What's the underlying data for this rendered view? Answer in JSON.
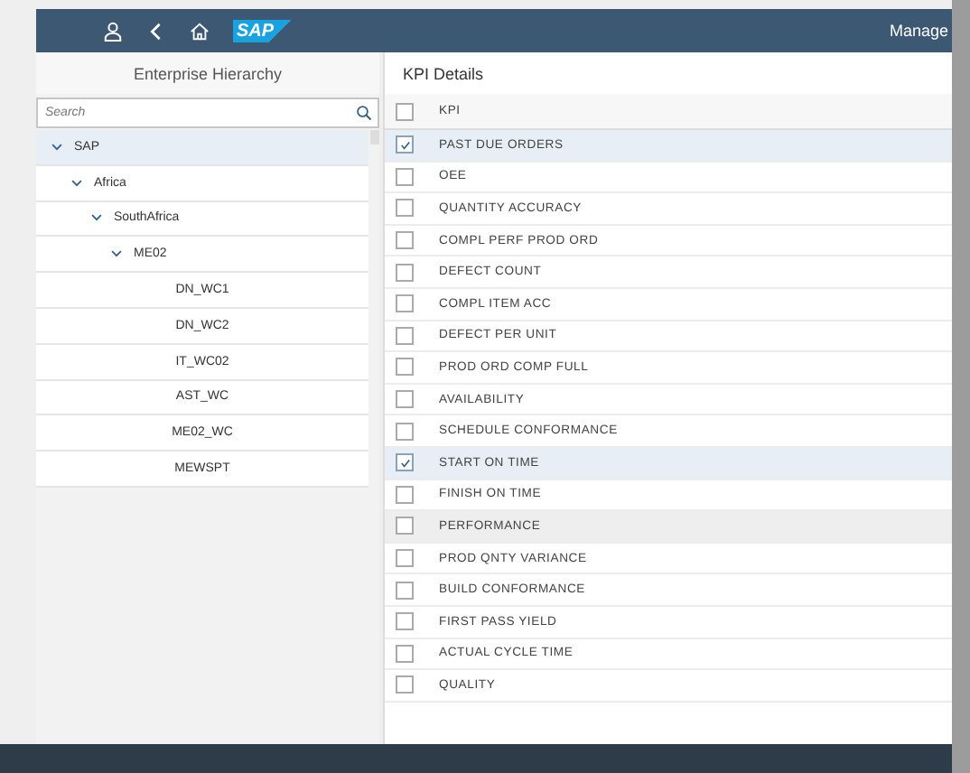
{
  "shell": {
    "title": "Manage",
    "logo": "SAP"
  },
  "hierarchy": {
    "title": "Enterprise Hierarchy",
    "search": {
      "placeholder": "Search"
    },
    "tree": [
      {
        "label": "SAP",
        "expanded": true,
        "selected": true,
        "children": [
          {
            "label": "Africa",
            "expanded": true,
            "selected": false,
            "children": [
              {
                "label": "SouthAfrica",
                "expanded": true,
                "selected": false,
                "children": [
                  {
                    "label": "ME02",
                    "expanded": true,
                    "selected": false,
                    "children": [
                      {
                        "label": "DN_WC1",
                        "selected": false
                      },
                      {
                        "label": "DN_WC2",
                        "selected": false
                      },
                      {
                        "label": "IT_WC02",
                        "selected": false
                      },
                      {
                        "label": "AST_WC",
                        "selected": false
                      },
                      {
                        "label": "ME02_WC",
                        "selected": false
                      },
                      {
                        "label": "MEWSPT",
                        "selected": false
                      }
                    ]
                  }
                ]
              }
            ]
          }
        ]
      }
    ]
  },
  "kpi": {
    "title": "KPI Details",
    "header": {
      "label": "KPI",
      "checked": false
    },
    "rows": [
      {
        "label": "PAST DUE ORDERS",
        "checked": true,
        "hovered": false
      },
      {
        "label": "OEE",
        "checked": false,
        "hovered": false
      },
      {
        "label": "QUANTITY ACCURACY",
        "checked": false,
        "hovered": false
      },
      {
        "label": "COMPL PERF PROD ORD",
        "checked": false,
        "hovered": false
      },
      {
        "label": "DEFECT COUNT",
        "checked": false,
        "hovered": false
      },
      {
        "label": "COMPL ITEM ACC",
        "checked": false,
        "hovered": false
      },
      {
        "label": "DEFECT PER UNIT",
        "checked": false,
        "hovered": false
      },
      {
        "label": "PROD ORD COMP FULL",
        "checked": false,
        "hovered": false
      },
      {
        "label": "AVAILABILITY",
        "checked": false,
        "hovered": false
      },
      {
        "label": "SCHEDULE CONFORMANCE",
        "checked": false,
        "hovered": false
      },
      {
        "label": "START ON TIME",
        "checked": true,
        "hovered": false
      },
      {
        "label": "FINISH ON TIME",
        "checked": false,
        "hovered": false
      },
      {
        "label": "PERFORMANCE",
        "checked": false,
        "hovered": true
      },
      {
        "label": "PROD QNTY VARIANCE",
        "checked": false,
        "hovered": false
      },
      {
        "label": "BUILD CONFORMANCE",
        "checked": false,
        "hovered": false
      },
      {
        "label": "FIRST PASS YIELD",
        "checked": false,
        "hovered": false
      },
      {
        "label": "ACTUAL CYCLE TIME",
        "checked": false,
        "hovered": false
      },
      {
        "label": "QUALITY",
        "checked": false,
        "hovered": false
      }
    ]
  }
}
